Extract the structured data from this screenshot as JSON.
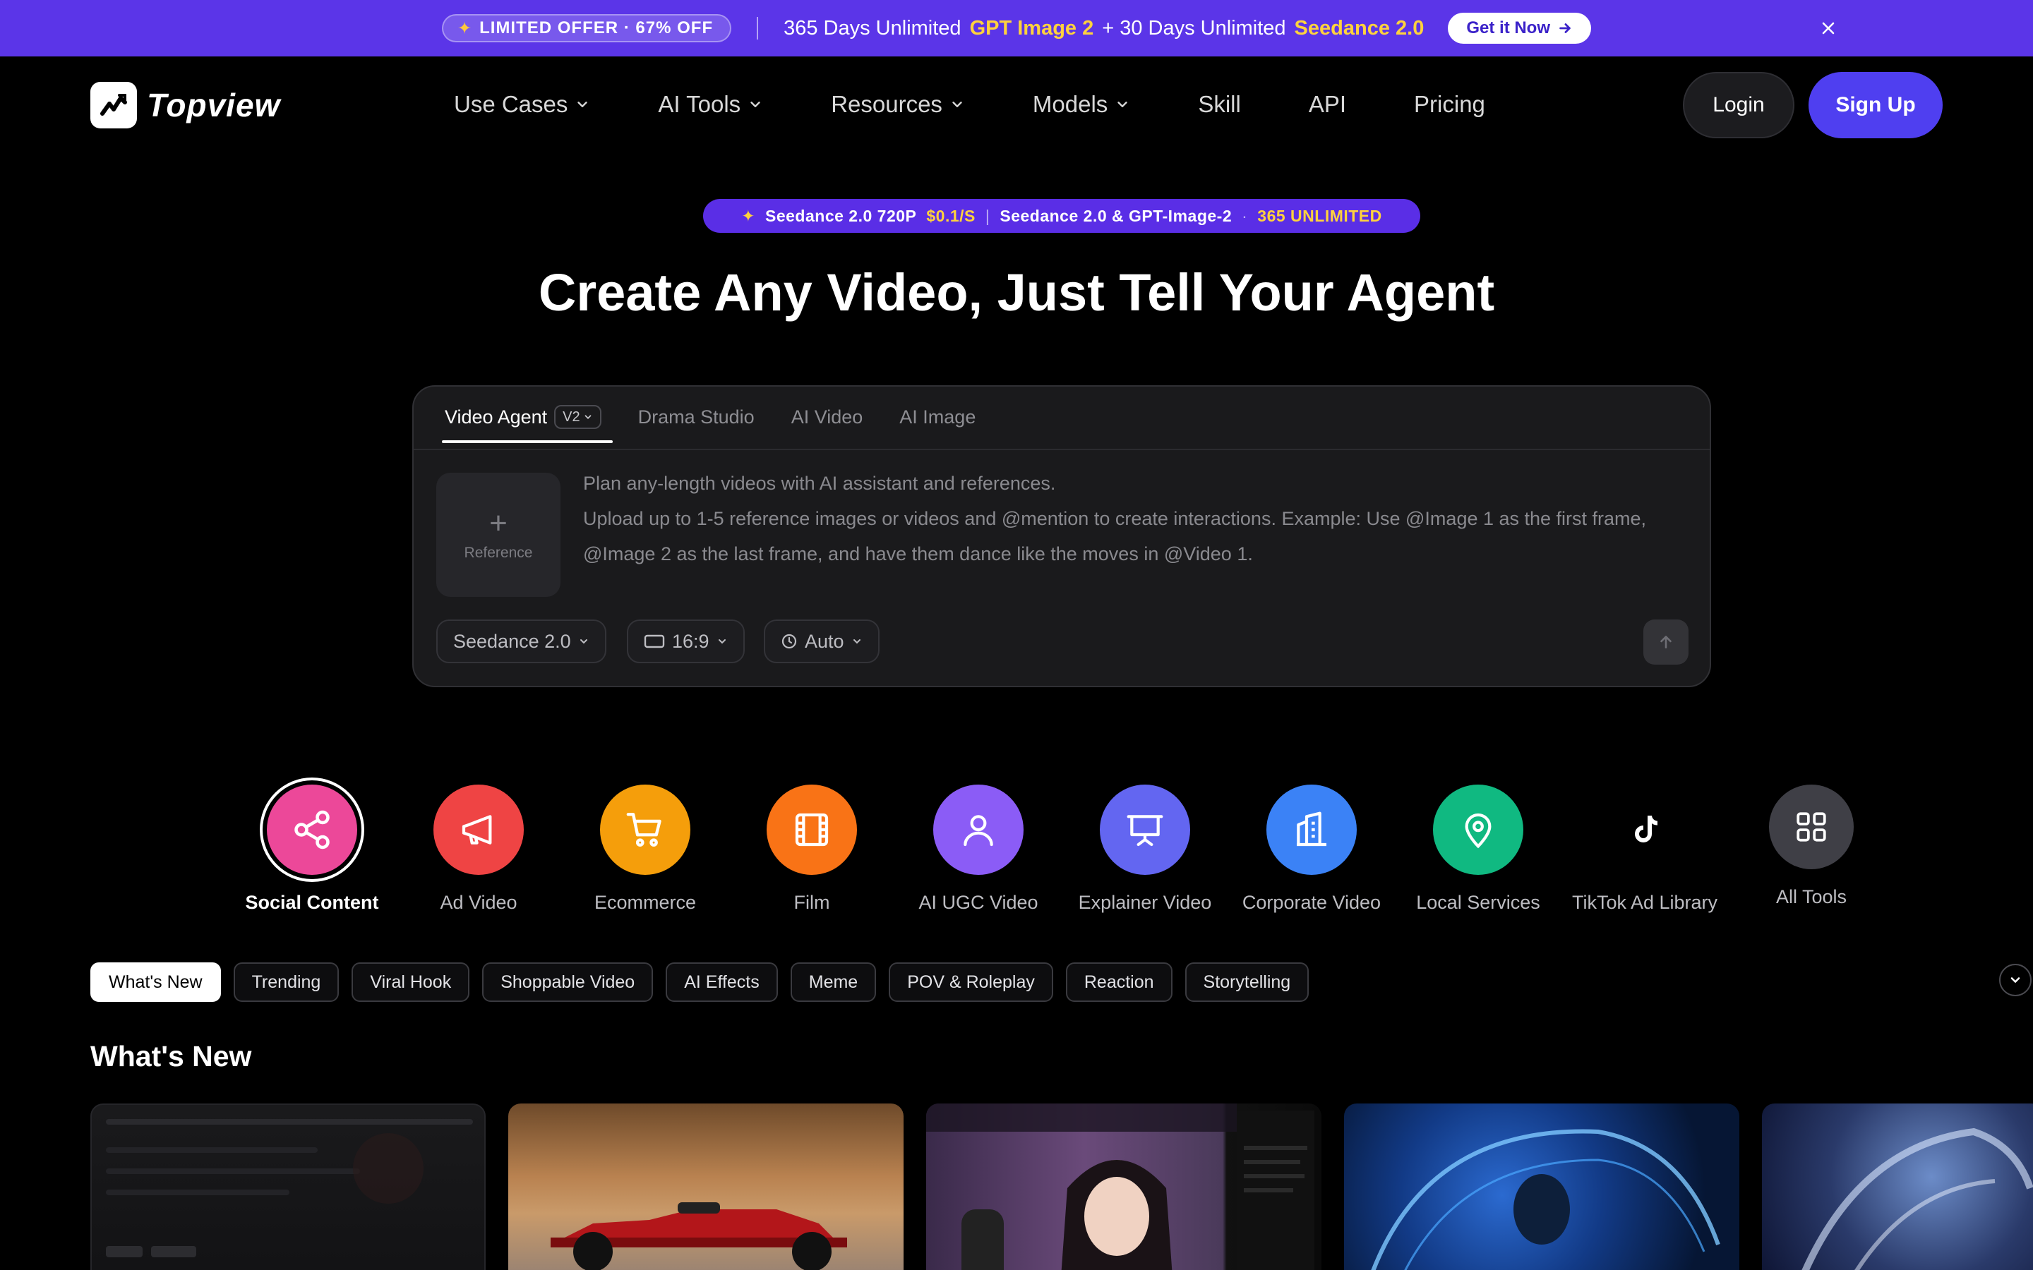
{
  "promo": {
    "offer": "LIMITED OFFER · 67% OFF",
    "text_a": "365 Days Unlimited",
    "highlight_a": "GPT Image 2",
    "text_b": "+ 30 Days Unlimited",
    "highlight_b": "Seedance 2.0",
    "cta": "Get it Now",
    "bg": "#5b35e8",
    "accent": "#ffd23d"
  },
  "nav": {
    "brand": "Topview",
    "items": [
      {
        "label": "Use Cases",
        "dropdown": true
      },
      {
        "label": "AI Tools",
        "dropdown": true
      },
      {
        "label": "Resources",
        "dropdown": true
      },
      {
        "label": "Models",
        "dropdown": true
      },
      {
        "label": "Skill",
        "dropdown": false
      },
      {
        "label": "API",
        "dropdown": false
      },
      {
        "label": "Pricing",
        "dropdown": false
      }
    ],
    "login": "Login",
    "signup": "Sign Up",
    "signup_color": "#4f3ff0"
  },
  "hero": {
    "badge": {
      "part1": "Seedance 2.0 720P",
      "price": "$0.1/S",
      "part2": "Seedance 2.0 & GPT-Image-2",
      "dot": "·",
      "part3": "365 UNLIMITED"
    },
    "title": "Create Any Video, Just Tell Your Agent"
  },
  "composer": {
    "tabs": [
      {
        "label": "Video Agent",
        "version": "V2",
        "active": true
      },
      {
        "label": "Drama Studio",
        "active": false
      },
      {
        "label": "AI Video",
        "active": false
      },
      {
        "label": "AI Image",
        "active": false
      }
    ],
    "reference_label": "Reference",
    "placeholder_line1": "Plan any-length videos with AI assistant and references.",
    "placeholder_line2": "Upload up to 1-5 reference images or videos and @mention to create interactions. Example: Use @Image 1 as the first frame, @Image 2 as the last frame, and have them dance like the moves in @Video 1.",
    "model": "Seedance 2.0",
    "ratio": "16:9",
    "duration": "Auto"
  },
  "categories": [
    {
      "label": "Social Content",
      "icon": "share-icon",
      "color": "#ec4899",
      "active": true
    },
    {
      "label": "Ad Video",
      "icon": "megaphone-icon",
      "color": "#ef4444",
      "active": false
    },
    {
      "label": "Ecommerce",
      "icon": "cart-icon",
      "color": "#f59e0b",
      "active": false
    },
    {
      "label": "Film",
      "icon": "film-icon",
      "color": "#f97316",
      "active": false
    },
    {
      "label": "AI UGC Video",
      "icon": "person-icon",
      "color": "#8b5cf6",
      "active": false
    },
    {
      "label": "Explainer Video",
      "icon": "presentation-icon",
      "color": "#6366f1",
      "active": false
    },
    {
      "label": "Corporate Video",
      "icon": "building-icon",
      "color": "#3b82f6",
      "active": false
    },
    {
      "label": "Local Services",
      "icon": "map-pin-icon",
      "color": "#10b981",
      "active": false
    },
    {
      "label": "TikTok Ad Library",
      "icon": "tiktok-icon",
      "color": "#000000",
      "active": false
    },
    {
      "label": "All Tools",
      "icon": "grid-icon",
      "color": "#3f3f46",
      "active": false
    }
  ],
  "filters": [
    "What's New",
    "Trending",
    "Viral Hook",
    "Shoppable Video",
    "AI Effects",
    "Meme",
    "POV & Roleplay",
    "Reaction",
    "Storytelling"
  ],
  "section_title": "What's New"
}
